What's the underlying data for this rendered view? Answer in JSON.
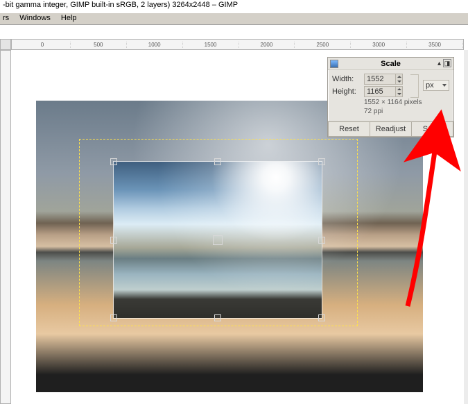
{
  "title": "-bit gamma integer, GIMP built-in sRGB, 2 layers) 3264x2448 – GIMP",
  "menu": {
    "filters": "rs",
    "windows": "Windows",
    "help": "Help"
  },
  "ruler_ticks": [
    "0",
    "500",
    "1000",
    "1500",
    "2000",
    "2500",
    "3000",
    "3500"
  ],
  "dialog": {
    "title": "Scale",
    "width_label": "Width:",
    "width_value": "1552",
    "height_label": "Height:",
    "height_value": "1165",
    "unit": "px",
    "info1": "1552 × 1164 pixels",
    "info2": "72 ppi",
    "reset": "Reset",
    "readjust": "Readjust",
    "scale": "Scale"
  }
}
